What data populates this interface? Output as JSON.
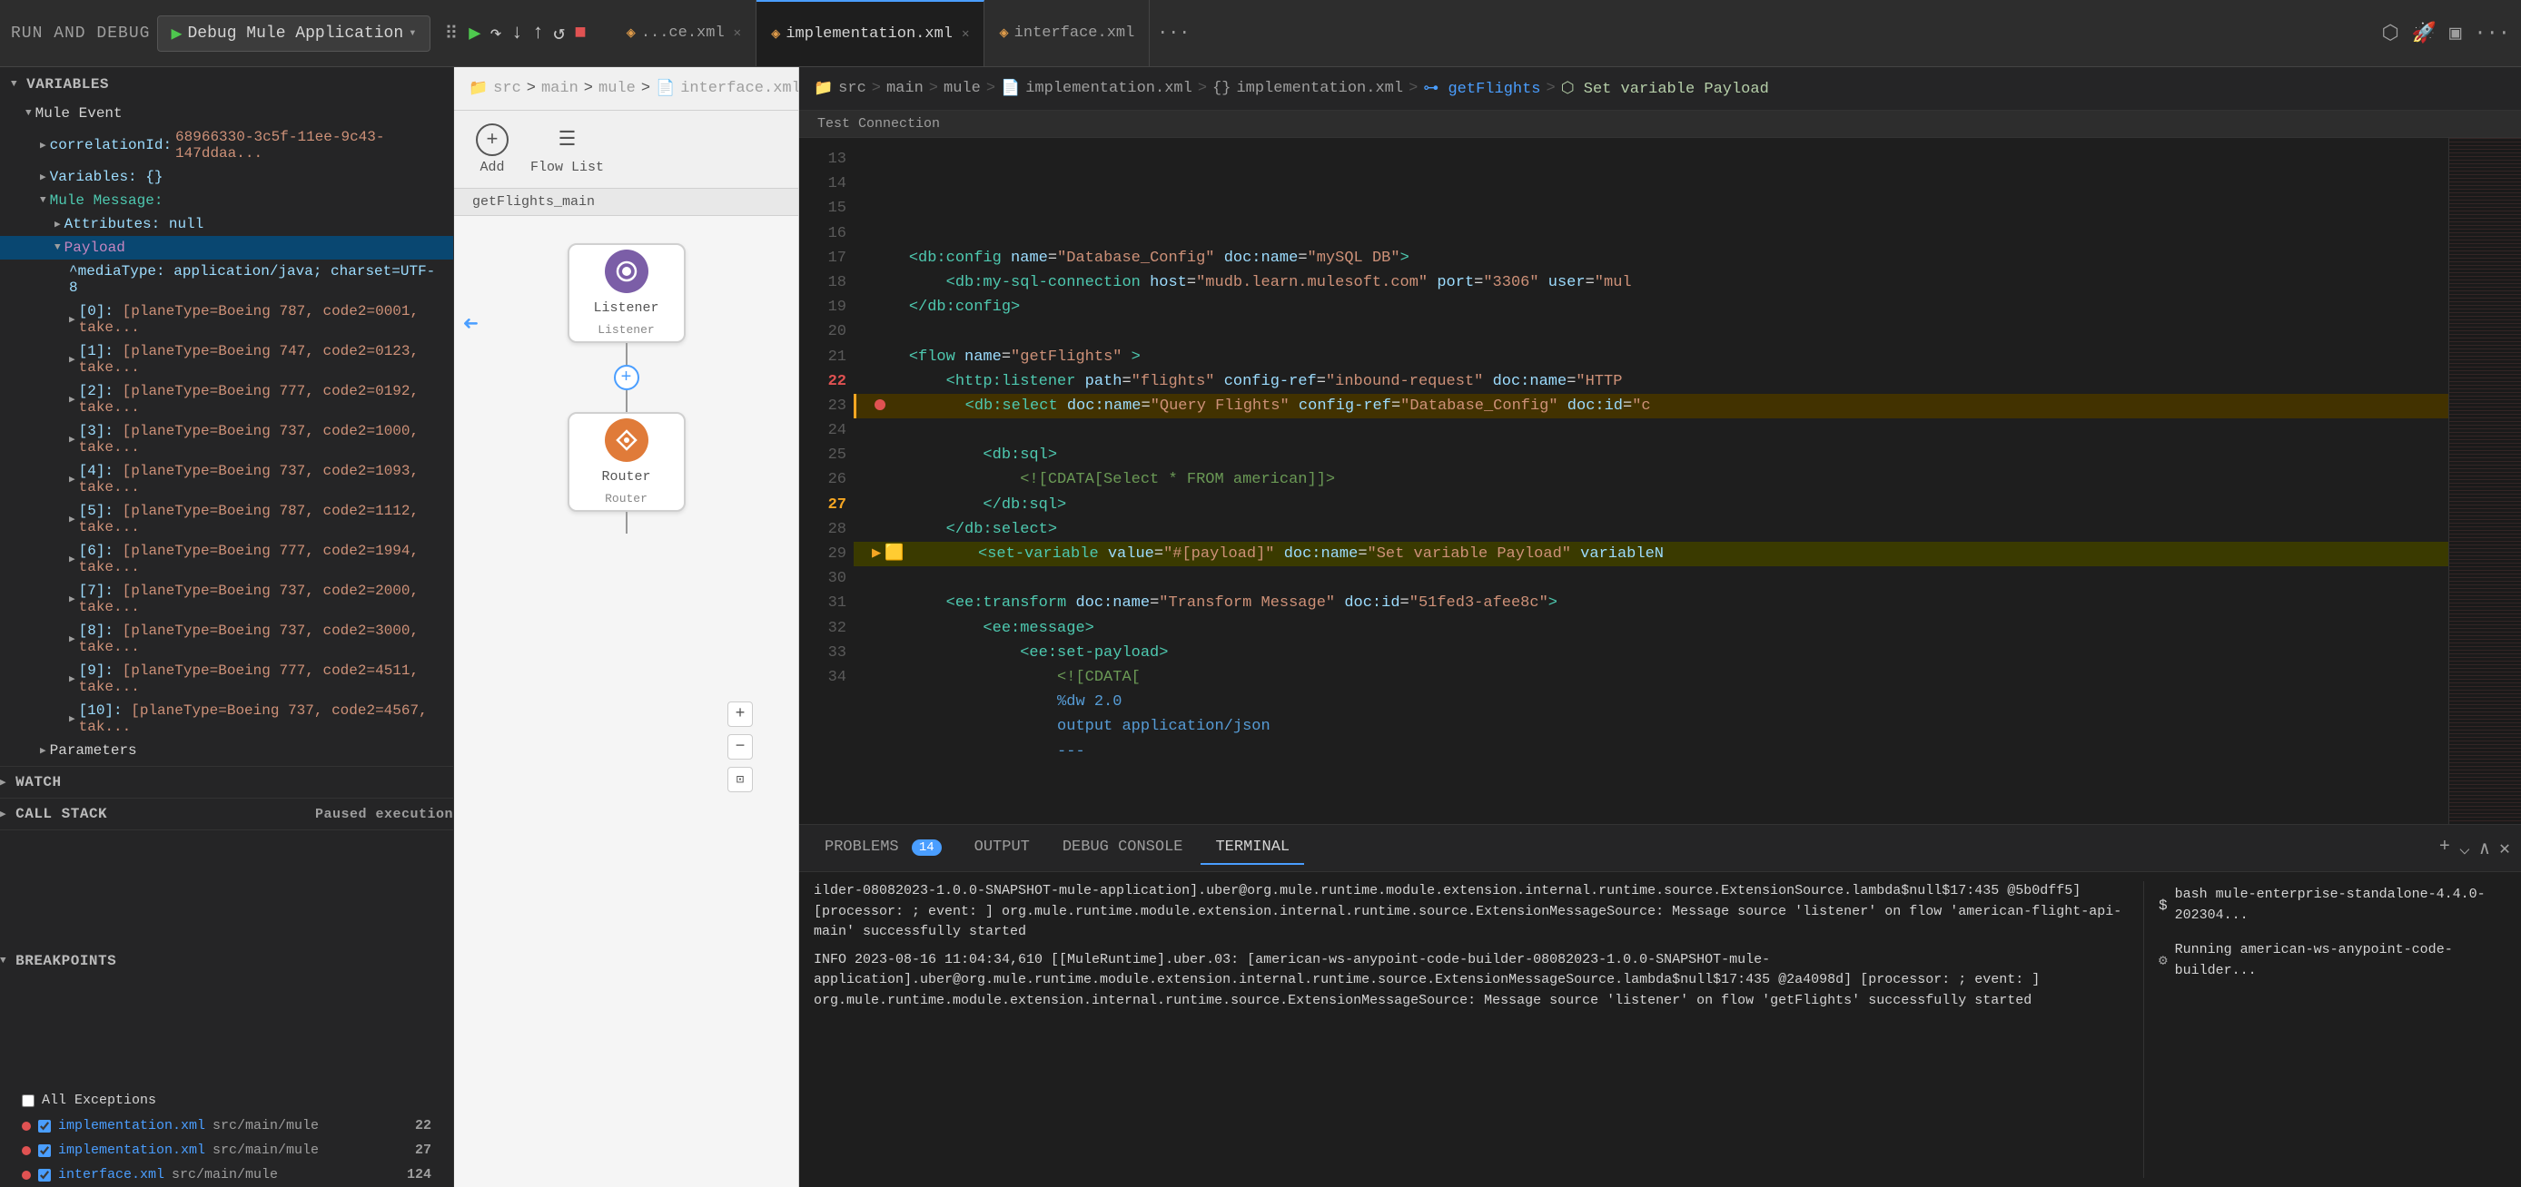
{
  "toolbar": {
    "run_debug_label": "RUN AND DEBUG",
    "debug_app_label": "Debug Mule Application",
    "chevron": "▾",
    "tabs": [
      {
        "id": "interface_ce",
        "label": "...ce.xml",
        "active": false,
        "icon": "xml"
      },
      {
        "id": "implementation",
        "label": "implementation.xml",
        "active": true,
        "icon": "xml"
      },
      {
        "id": "interface_xml",
        "label": "interface.xml",
        "active": false,
        "icon": "xml"
      }
    ],
    "more_label": "···"
  },
  "breadcrumb": {
    "impl": {
      "parts": [
        "src",
        ">",
        "main",
        ">",
        "mule",
        ">",
        "implementation.xml",
        ">",
        "{} implementation.xml",
        ">",
        "⊶ getFlights",
        ">",
        "⬡ Set variable Payload"
      ]
    },
    "iface": {
      "parts": [
        "src",
        ">",
        "main",
        ">",
        "mule",
        ">",
        "interface.xml"
      ]
    }
  },
  "debug_panel": {
    "variables_label": "VARIABLES",
    "mule_event_label": "Mule Event",
    "correlation_id_label": "correlationId:",
    "correlation_id_value": "68966330-3c5f-11ee-9c43-147ddaa...",
    "variables_item": "Variables: {}",
    "mule_message_label": "Mule Message:",
    "attributes_label": "Attributes: null",
    "payload_label": "Payload",
    "media_type": "^mediaType: application/java; charset=UTF-8",
    "items": [
      "[0]: [planeType=Boeing 787, code2=0001, take...",
      "[1]: [planeType=Boeing 747, code2=0123, take...",
      "[2]: [planeType=Boeing 777, code2=0192, take...",
      "[3]: [planeType=Boeing 737, code2=1000, take...",
      "[4]: [planeType=Boeing 737, code2=1093, take...",
      "[5]: [planeType=Boeing 787, code2=1112, take...",
      "[6]: [planeType=Boeing 777, code2=1994, take...",
      "[7]: [planeType=Boeing 737, code2=2000, take...",
      "[8]: [planeType=Boeing 737, code2=3000, take...",
      "[9]: [planeType=Boeing 777, code2=4511, take...",
      "[10]: [planeType=Boeing 737, code2=4567, tak..."
    ],
    "parameters_label": "Parameters",
    "watch_label": "WATCH",
    "call_stack_label": "CALL STACK",
    "paused_label": "Paused execution",
    "breakpoints_label": "BREAKPOINTS",
    "all_exceptions_label": "All Exceptions",
    "breakpoints": [
      {
        "file": "implementation.xml",
        "path": "src/main/mule",
        "line": "22"
      },
      {
        "file": "implementation.xml",
        "path": "src/main/mule",
        "line": "27"
      },
      {
        "file": "interface.xml",
        "path": "src/main/mule",
        "line": "124"
      }
    ]
  },
  "flow_canvas": {
    "add_label": "Add",
    "flow_list_label": "Flow List",
    "flow_title": "getFlights_main",
    "nodes": [
      {
        "id": "listener",
        "label": "Listener",
        "sub_label": "Listener",
        "icon_type": "listener"
      },
      {
        "id": "router",
        "label": "Router",
        "sub_label": "Router",
        "icon_type": "router"
      }
    ]
  },
  "editor": {
    "test_connection_label": "Test Connection",
    "lines": [
      {
        "num": "13",
        "content": "",
        "type": "normal"
      },
      {
        "num": "14",
        "content": "",
        "type": "normal"
      },
      {
        "num": "15",
        "content": "",
        "type": "normal"
      },
      {
        "num": "16",
        "content": "    <db:config name=\"Database_Config\" doc:name=\"mySQL DB\">",
        "type": "normal"
      },
      {
        "num": "17",
        "content": "        <db:my-sql-connection host=\"mudb.learn.mulesoft.com\" port=\"3306\" user=\"mul",
        "type": "normal"
      },
      {
        "num": "18",
        "content": "    </db:config>",
        "type": "normal"
      },
      {
        "num": "19",
        "content": "",
        "type": "normal"
      },
      {
        "num": "20",
        "content": "    <flow name=\"getFlights\" >",
        "type": "normal"
      },
      {
        "num": "21",
        "content": "        <http:listener path=\"flights\" config-ref=\"inbound-request\" doc:name=\"HTTP",
        "type": "normal"
      },
      {
        "num": "22",
        "content": "        <db:select doc:name=\"Query Flights\" config-ref=\"Database_Config\" doc:id=\"c",
        "type": "breakpoint"
      },
      {
        "num": "23",
        "content": "            <db:sql>",
        "type": "normal"
      },
      {
        "num": "24",
        "content": "                <![CDATA[Select * FROM american]]>",
        "type": "normal"
      },
      {
        "num": "25",
        "content": "            </db:sql>",
        "type": "normal"
      },
      {
        "num": "26",
        "content": "        </db:select>",
        "type": "normal"
      },
      {
        "num": "27",
        "content": "        <set-variable value=\"#[payload]\" doc:name=\"Set variable Payload\" variableN",
        "type": "debug"
      },
      {
        "num": "28",
        "content": "        <ee:transform doc:name=\"Transform Message\" doc:id=\"51fed3-afee8c\">",
        "type": "normal"
      },
      {
        "num": "29",
        "content": "            <ee:message>",
        "type": "normal"
      },
      {
        "num": "30",
        "content": "                <ee:set-payload>",
        "type": "normal"
      },
      {
        "num": "31",
        "content": "                    <![CDATA[",
        "type": "normal"
      },
      {
        "num": "32",
        "content": "                    %dw 2.0",
        "type": "dw"
      },
      {
        "num": "33",
        "content": "                    output application/json",
        "type": "dw"
      },
      {
        "num": "34",
        "content": "                    ---",
        "type": "dw"
      }
    ]
  },
  "bottom_panel": {
    "tabs": [
      {
        "id": "problems",
        "label": "PROBLEMS",
        "badge": "14",
        "active": false
      },
      {
        "id": "output",
        "label": "OUTPUT",
        "badge": null,
        "active": false
      },
      {
        "id": "debug_console",
        "label": "DEBUG CONSOLE",
        "badge": null,
        "active": false
      },
      {
        "id": "terminal",
        "label": "TERMINAL",
        "badge": null,
        "active": true
      }
    ],
    "terminal_text": "ilder-08082023-1.0.0-SNAPSHOT-mule-application].uber@org.mule.runtime.module.extension.internal.runtime.source.ExtensionSource.lambda$null$17:435 @5b0dff5] [processor: ; event: ] org.mule.runtime.module.extension.internal.runtime.source.ExtensionMessageSource: Message source 'listener' on flow 'american-flight-api-main' successfully started\nINFO  2023-08-16 11:04:34,610 [[MuleRuntime].uber.03: [american-ws-anypoint-code-builder-08082023-1.0.0-SNAPSHOT-mule-application].uber@org.mule.runtime.module.extension.internal.runtime.source.ExtensionMessageSource.lambda$null$17:435 @2a4098d] [processor: ; event: ] org.mule.runtime.module.extension.internal.runtime.source.ExtensionMessageSource: Message source 'listener' on flow 'getFlights' successfully started",
    "bash_label": "bash  mule-enterprise-standalone-4.4.0-202304...",
    "running_label": "Running american-ws-anypoint-code-builder..."
  }
}
